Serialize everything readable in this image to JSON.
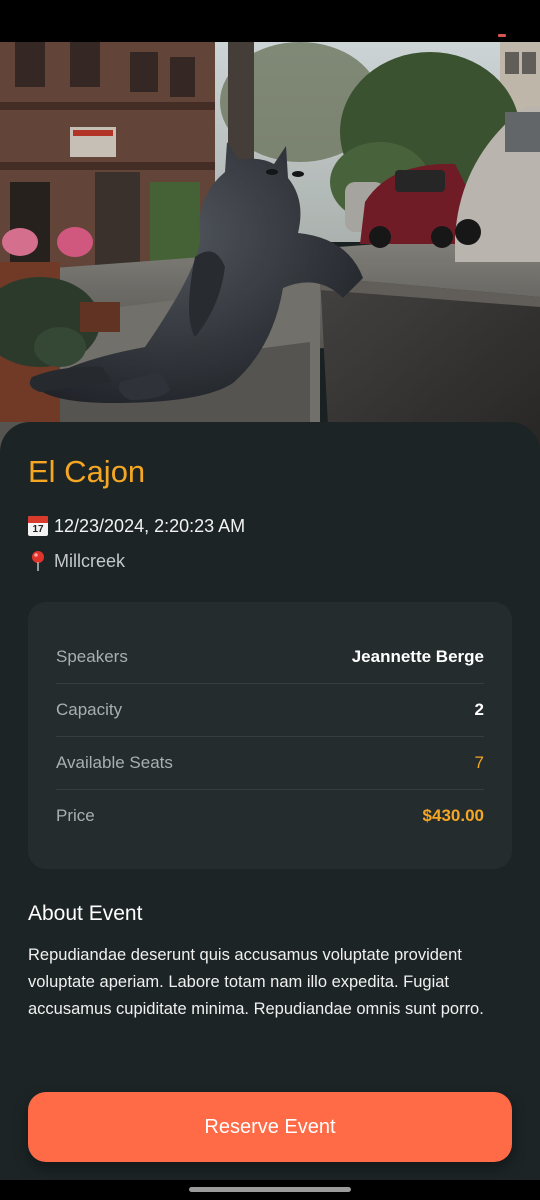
{
  "event": {
    "title": "El Cajon",
    "date_time": "12/23/2024, 2:20:23 AM",
    "location": "Millcreek",
    "calendar_icon_day": "17",
    "calendar_icon_month": "JUL"
  },
  "details": [
    {
      "label": "Speakers",
      "value": "Jeannette Berge"
    },
    {
      "label": "Capacity",
      "value": "2"
    },
    {
      "label": "Available Seats",
      "value": "7"
    },
    {
      "label": "Price",
      "value": "$430.00"
    }
  ],
  "about": {
    "title": "About Event",
    "body": "Repudiandae deserunt quis accusamus voluptate provident voluptate aperiam. Labore totam nam illo expedita. Fugiat accusamus cupiditate minima. Repudiandae omnis sunt porro."
  },
  "actions": {
    "reserve_label": "Reserve Event"
  },
  "hero": {
    "image_subject": "bronze cat statue reclining on a curb on a city street"
  },
  "icons": {
    "date": "calendar-icon",
    "location": "map-pin-icon"
  },
  "colors": {
    "background": "#1c2426",
    "card": "#242c2e",
    "accent": "#f5a623",
    "button": "#ff6b47"
  }
}
